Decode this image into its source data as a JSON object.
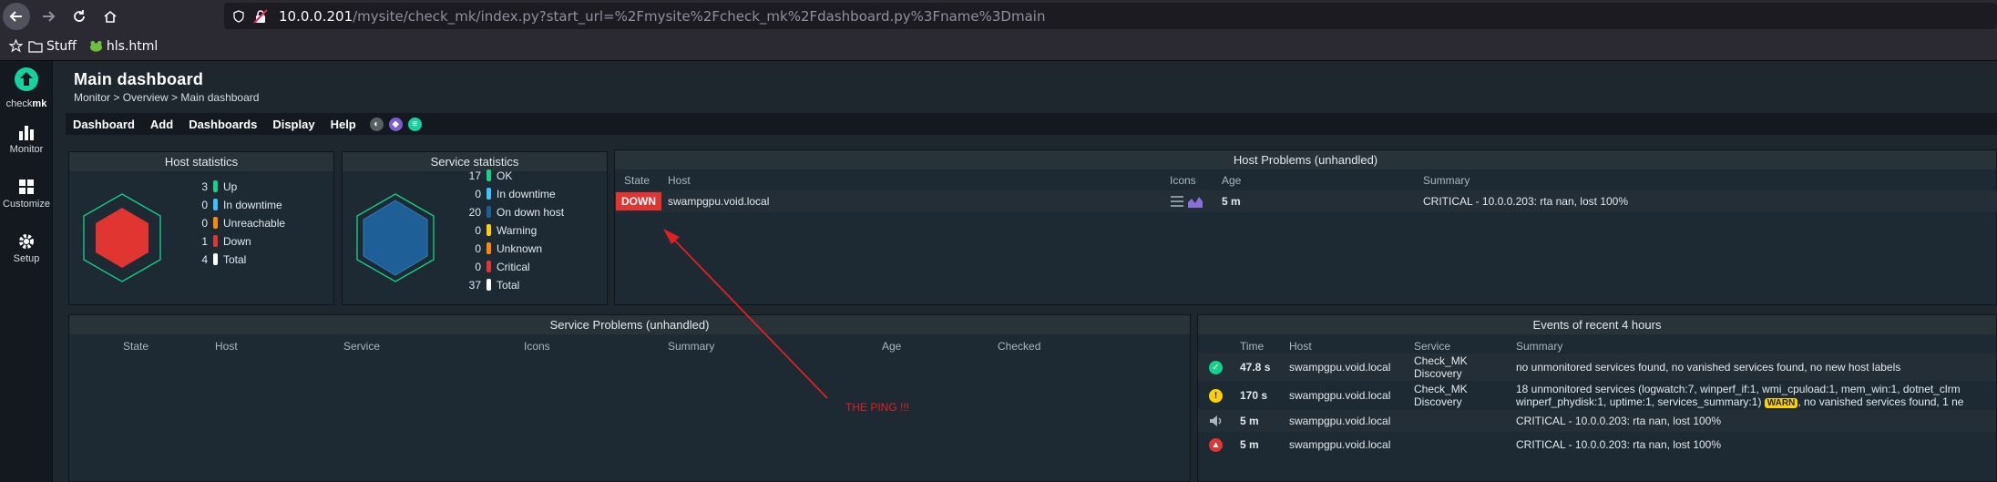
{
  "browser": {
    "url_host": "10.0.0.201",
    "url_path": "/mysite/check_mk/index.py?start_url=%2Fmysite%2Fcheck_mk%2Fdashboard.py%3Fname%3Dmain",
    "bookmarks": [
      "Stuff",
      "hls.html"
    ]
  },
  "sidebar": {
    "logo_check": "check",
    "logo_mk": "mk",
    "items": [
      "Monitor",
      "Customize",
      "Setup"
    ]
  },
  "page": {
    "title": "Main dashboard",
    "breadcrumb": "Monitor > Overview > Main dashboard"
  },
  "menu": [
    "Dashboard",
    "Add",
    "Dashboards",
    "Display",
    "Help"
  ],
  "host_stats": {
    "title": "Host statistics",
    "rows": [
      {
        "n": "3",
        "label": "Up",
        "color": "#13d389"
      },
      {
        "n": "0",
        "label": "In downtime",
        "color": "#3cc2ff"
      },
      {
        "n": "0",
        "label": "Unreachable",
        "color": "#ff8a00"
      },
      {
        "n": "1",
        "label": "Down",
        "color": "#e03531"
      },
      {
        "n": "4",
        "label": "Total",
        "color": "#ffffff"
      }
    ]
  },
  "service_stats": {
    "title": "Service statistics",
    "rows": [
      {
        "n": "17",
        "label": "OK",
        "color": "#13d389"
      },
      {
        "n": "0",
        "label": "In downtime",
        "color": "#3cc2ff"
      },
      {
        "n": "20",
        "label": "On down host",
        "color": "#1e5f97"
      },
      {
        "n": "0",
        "label": "Warning",
        "color": "#ffd000"
      },
      {
        "n": "0",
        "label": "Unknown",
        "color": "#ff8a00"
      },
      {
        "n": "0",
        "label": "Critical",
        "color": "#e03531"
      },
      {
        "n": "37",
        "label": "Total",
        "color": "#ffffff"
      }
    ]
  },
  "host_problems": {
    "title": "Host Problems (unhandled)",
    "headers": {
      "state": "State",
      "host": "Host",
      "icons": "Icons",
      "age": "Age",
      "summary": "Summary"
    },
    "rows": [
      {
        "state": "DOWN",
        "host": "swampgpu.void.local",
        "age": "5 m",
        "summary": "CRITICAL - 10.0.0.203: rta nan, lost 100%"
      }
    ]
  },
  "service_problems": {
    "title": "Service Problems (unhandled)",
    "headers": {
      "state": "State",
      "host": "Host",
      "service": "Service",
      "icons": "Icons",
      "summary": "Summary",
      "age": "Age",
      "checked": "Checked"
    }
  },
  "events": {
    "title": "Events of recent 4 hours",
    "headers": {
      "time": "Time",
      "host": "Host",
      "service": "Service",
      "summary": "Summary"
    },
    "rows": [
      {
        "icon": "ok",
        "time": "47.8 s",
        "host": "swampgpu.void.local",
        "service_1": "Check_MK",
        "service_2": "Discovery",
        "summary_1": "no unmonitored services found, no vanished services found, no new host labels",
        "summary_2": ""
      },
      {
        "icon": "warn",
        "time": "170 s",
        "host": "swampgpu.void.local",
        "service_1": "Check_MK",
        "service_2": "Discovery",
        "summary_1": "18 unmonitored services (logwatch:7, winperf_if:1, wmi_cpuload:1, mem_win:1, dotnet_clrm",
        "summary_2": "winperf_phydisk:1, uptime:1, services_summary:1)",
        "warn_badge": "WARN",
        "summary_3": ", no vanished services found, 1 ne"
      },
      {
        "icon": "notify",
        "time": "5 m",
        "host": "swampgpu.void.local",
        "service_1": "",
        "service_2": "",
        "summary_1": "CRITICAL - 10.0.0.203: rta nan, lost 100%",
        "summary_2": ""
      },
      {
        "icon": "crit",
        "time": "5 m",
        "host": "swampgpu.void.local",
        "service_1": "",
        "service_2": "",
        "summary_1": "CRITICAL - 10.0.0.203: rta nan, lost 100%",
        "summary_2": ""
      }
    ]
  },
  "annotation": "THE PING !!!"
}
